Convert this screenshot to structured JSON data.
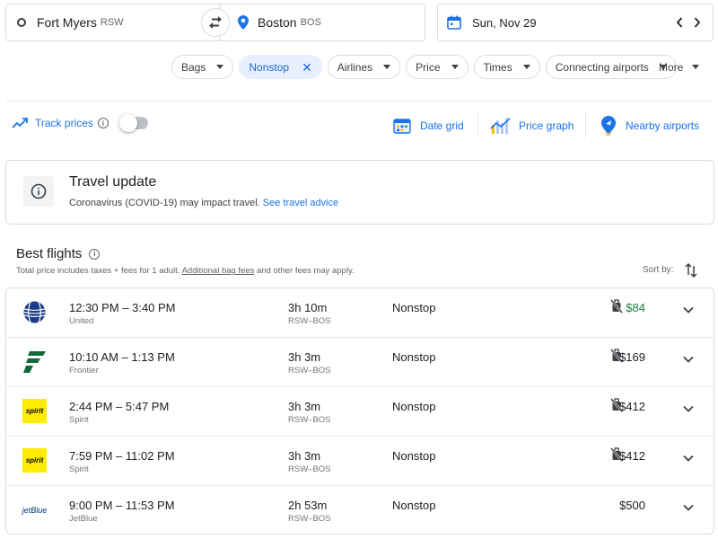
{
  "search": {
    "origin_city": "Fort Myers",
    "origin_code": "RSW",
    "dest_city": "Boston",
    "dest_code": "BOS",
    "date": "Sun, Nov 29"
  },
  "filters": {
    "chips": [
      {
        "label": "Bags",
        "active": false
      },
      {
        "label": "Nonstop",
        "active": true
      },
      {
        "label": "Airlines",
        "active": false
      },
      {
        "label": "Price",
        "active": false
      },
      {
        "label": "Times",
        "active": false
      },
      {
        "label": "Connecting airports",
        "active": false
      }
    ],
    "more": "More"
  },
  "tools": {
    "track_prices": "Track prices",
    "date_grid": "Date grid",
    "price_graph": "Price graph",
    "nearby_airports": "Nearby airports"
  },
  "update": {
    "title": "Travel update",
    "text": "Coronavirus (COVID-19) may impact travel. ",
    "link": "See travel advice"
  },
  "best": {
    "title": "Best flights",
    "subtitle_pre": "Total price includes taxes + fees for 1 adult. ",
    "subtitle_link": "Additional bag fees",
    "subtitle_post": " and other fees may apply.",
    "sort_label": "Sort by:"
  },
  "colors": {
    "accent": "#1a73e8",
    "price_low": "#188038",
    "chip_active_bg": "#e8f0fe"
  },
  "flights": [
    {
      "times": "12:30 PM – 3:40 PM",
      "airline": "United",
      "logo": "united-logo",
      "duration": "3h 10m",
      "route": "RSW–BOS",
      "stops": "Nonstop",
      "price": "$84",
      "low": true,
      "bag_icon": true
    },
    {
      "times": "10:10 AM – 1:13 PM",
      "airline": "Frontier",
      "logo": "frontier-logo",
      "duration": "3h 3m",
      "route": "RSW–BOS",
      "stops": "Nonstop",
      "price": "$169",
      "low": false,
      "bag_icon": true
    },
    {
      "times": "2:44 PM – 5:47 PM",
      "airline": "Spirit",
      "logo": "spirit-logo",
      "logo_text": "spirit",
      "duration": "3h 3m",
      "route": "RSW–BOS",
      "stops": "Nonstop",
      "price": "$412",
      "low": false,
      "bag_icon": true
    },
    {
      "times": "7:59 PM – 11:02 PM",
      "airline": "Spirit",
      "logo": "spirit-logo",
      "logo_text": "spirit",
      "duration": "3h 3m",
      "route": "RSW–BOS",
      "stops": "Nonstop",
      "price": "$412",
      "low": false,
      "bag_icon": true
    },
    {
      "times": "9:00 PM – 11:53 PM",
      "airline": "JetBlue",
      "logo": "jetblue-logo",
      "logo_text": "jetBlue",
      "duration": "2h 53m",
      "route": "RSW–BOS",
      "stops": "Nonstop",
      "price": "$500",
      "low": false,
      "bag_icon": false
    }
  ]
}
